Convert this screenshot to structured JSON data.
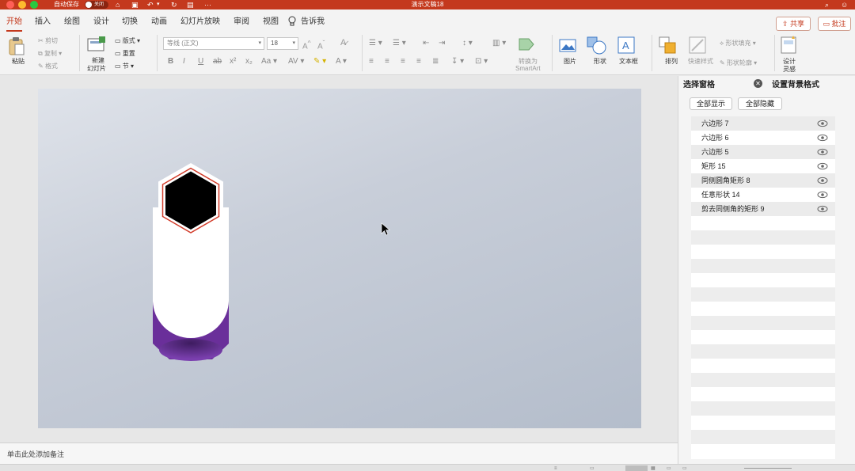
{
  "titlebar": {
    "autosave_label": "自动保存",
    "autosave_state": "关闭",
    "doc_title": "演示文稿18",
    "bg_color": "#c4391d"
  },
  "tabs": [
    {
      "label": "开始",
      "active": true
    },
    {
      "label": "插入"
    },
    {
      "label": "绘图"
    },
    {
      "label": "设计"
    },
    {
      "label": "切换"
    },
    {
      "label": "动画"
    },
    {
      "label": "幻灯片放映"
    },
    {
      "label": "审阅"
    },
    {
      "label": "视图"
    },
    {
      "label": "告诉我"
    }
  ],
  "share_label": "共享",
  "comment_label": "批注",
  "ribbon": {
    "paste": "粘贴",
    "cut": "剪切",
    "copy": "复制",
    "format": "格式",
    "new_slide_line1": "新建",
    "new_slide_line2": "幻灯片",
    "layout": "版式",
    "reset": "重置",
    "section": "节",
    "font_name": "等线 (正文)",
    "font_size": "18",
    "convert_line1": "转换为",
    "convert_line2": "SmartArt",
    "picture": "图片",
    "shape": "形状",
    "textbox": "文本框",
    "arrange": "排列",
    "quick_styles": "快速样式",
    "shape_fill": "形状填充",
    "shape_outline": "形状轮廓",
    "designer_line1": "设计",
    "designer_line2": "灵感"
  },
  "notes_placeholder": "单击此处添加备注",
  "pane": {
    "tab_selection": "选择窗格",
    "tab_format_bg": "设置背景格式",
    "show_all": "全部显示",
    "hide_all": "全部隐藏",
    "items": [
      {
        "label": "六边形 7"
      },
      {
        "label": "六边形 6"
      },
      {
        "label": "六边形 5"
      },
      {
        "label": "矩形 15"
      },
      {
        "label": "同侧圆角矩形 8"
      },
      {
        "label": "任意形状 14"
      },
      {
        "label": "剪去同侧角的矩形 9"
      }
    ]
  },
  "colors": {
    "accent": "#c4391d",
    "shape_purple": "#6a2f9a",
    "hexagon_fill": "#000000",
    "hexagon_outline": "#d23c2a"
  },
  "icons": [
    "close-icon",
    "save-icon",
    "undo-icon",
    "redo-icon",
    "print-icon",
    "lightbulb-icon",
    "eye-icon",
    "account-icon"
  ]
}
